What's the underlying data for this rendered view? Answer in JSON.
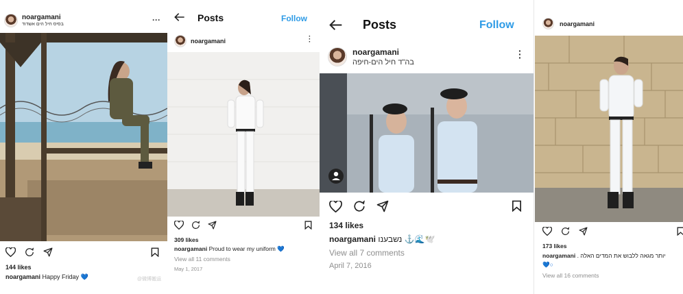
{
  "posts": [
    {
      "username": "noargamani",
      "location": "בסיס חיל הים אשדוד",
      "more_icon": "more-horizontal-icon",
      "likes": "144 likes",
      "caption_user": "noargamani",
      "caption_text": "Happy Friday",
      "caption_emoji": "💙",
      "watermark": "@微博搬运"
    },
    {
      "header_title": "Posts",
      "follow_label": "Follow",
      "username": "noargamani",
      "more_icon": "more-vertical-icon",
      "likes": "309 likes",
      "caption_user": "noargamani",
      "caption_text": "Proud to wear my uniform",
      "caption_emoji": "💙",
      "comments": "View all 11 comments",
      "date": "May 1, 2017"
    },
    {
      "header_title": "Posts",
      "follow_label": "Follow",
      "username": "noargamani",
      "location": "בה\"ד חיל הים-חיפה",
      "more_icon": "more-vertical-icon",
      "likes": "134 likes",
      "caption_user": "noargamani",
      "caption_text": "נשבענו ⚓🌊🕊️",
      "comments": "View all 7 comments",
      "date": "April 7, 2016"
    },
    {
      "username": "noargamani",
      "likes": "173 likes",
      "caption_user": "noargamani",
      "caption_text": "יותר מגאה ללבוש את המדים האלה .",
      "caption_line2": "💙○",
      "comments": "View all 16 comments"
    }
  ],
  "colors": {
    "follow_blue": "#2e9be6",
    "muted_gray": "#8e8e8e"
  }
}
